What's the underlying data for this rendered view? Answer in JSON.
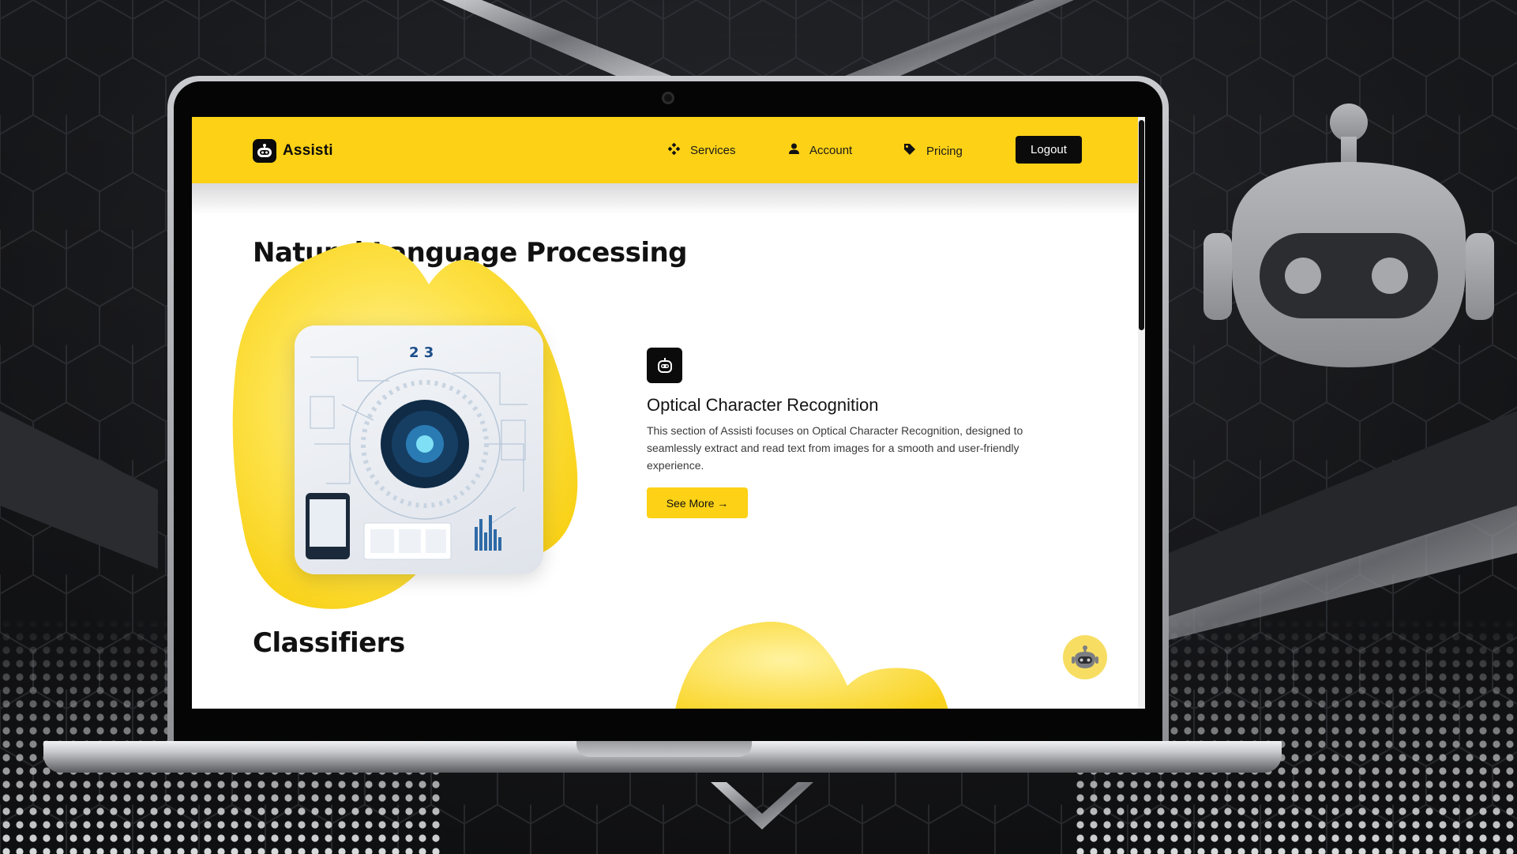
{
  "brand": {
    "name": "Assisti"
  },
  "nav": {
    "items": [
      {
        "label": "Services",
        "icon": "diamond-grid-icon"
      },
      {
        "label": "Account",
        "icon": "user-icon"
      },
      {
        "label": "Pricing",
        "icon": "tag-icon"
      }
    ],
    "logout_label": "Logout"
  },
  "sections": {
    "nlp_title": "Natural Language Processing",
    "classifiers_title": "Classifiers"
  },
  "feature": {
    "icon": "robot-icon",
    "title": "Optical Character Recognition",
    "description": "This section of Assisti focuses on Optical Character Recognition, designed to seamlessly extract and read text from images for a smooth and user-friendly experience.",
    "cta_label": "See More →",
    "image_digits": "2 3"
  },
  "colors": {
    "accent": "#fcd116",
    "dark": "#0b0b0b",
    "chat_bubble": "#f7de62"
  }
}
